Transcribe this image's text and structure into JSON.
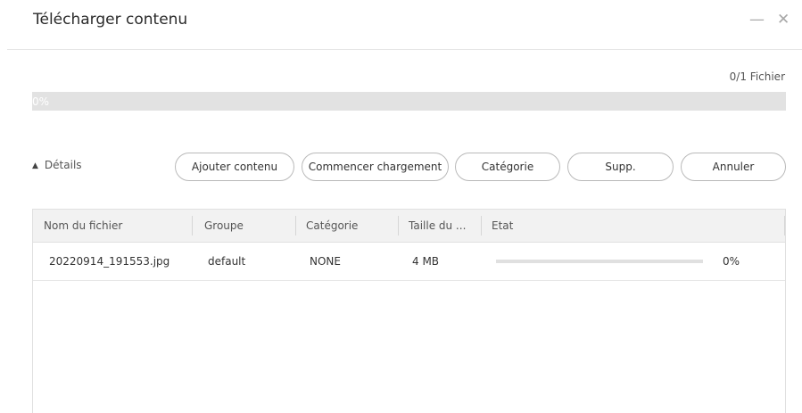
{
  "window": {
    "title": "Télécharger contenu",
    "minimize_glyph": "—",
    "close_glyph": "✕"
  },
  "progress": {
    "file_count": "0/1 Fichier",
    "percent_label": "0%",
    "fraction": 0
  },
  "details": {
    "toggle_label": "Détails",
    "toggle_icon": "chevron-up-icon"
  },
  "toolbar": {
    "add_label": "Ajouter contenu",
    "start_label": "Commencer chargement",
    "category_label": "Catégorie",
    "delete_label": "Supp.",
    "cancel_label": "Annuler"
  },
  "table": {
    "columns": [
      "Nom du fichier",
      "Groupe",
      "Catégorie",
      "Taille du ...",
      "Etat"
    ],
    "rows": [
      {
        "name": "20220914_191553.jpg",
        "group": "default",
        "category": "NONE",
        "size": "4 MB",
        "progress_fraction": 0,
        "percent": "0%"
      }
    ]
  },
  "colors": {
    "progress_track": "#e2e2e2",
    "progress_fill": "#4a90d9"
  }
}
